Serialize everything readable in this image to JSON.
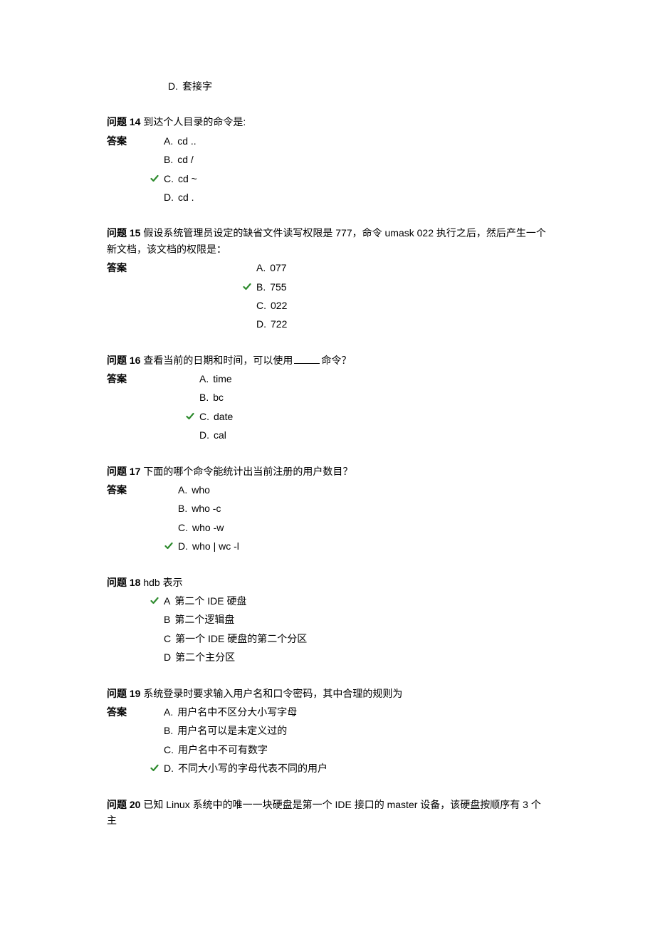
{
  "orphan_option": {
    "letter": "D.",
    "text": "套接字",
    "correct": false
  },
  "questions": [
    {
      "number": "问题 14",
      "text_before": "到达个人目录的命令是:",
      "text_after": "",
      "answer_label": "答案",
      "indent": 60,
      "options": [
        {
          "letter": "A.",
          "text": "cd ..",
          "correct": false
        },
        {
          "letter": "B.",
          "text": "cd /",
          "correct": false
        },
        {
          "letter": "C.",
          "text": "cd ~",
          "correct": true
        },
        {
          "letter": "D.",
          "text": "cd .",
          "correct": false
        }
      ]
    },
    {
      "number": "问题 15",
      "text_before": "假设系统管理员设定的缺省文件读写权限是 777，命令 umask 022 执行之后，然后产生一个新文档，该文档的权限是：",
      "text_after": "",
      "answer_label": "答案",
      "indent": 190,
      "options": [
        {
          "letter": "A.",
          "text": "077",
          "correct": false
        },
        {
          "letter": "B.",
          "text": "755",
          "correct": true
        },
        {
          "letter": "C.",
          "text": " 022",
          "correct": false
        },
        {
          "letter": "D.",
          "text": "722",
          "correct": false
        }
      ]
    },
    {
      "number": "问题 16",
      "text_before": "查看当前的日期和时间，可以使用",
      "text_after": "命令？",
      "has_blank": true,
      "answer_label": "答案",
      "indent": 110,
      "options": [
        {
          "letter": "A.",
          "text": "time",
          "correct": false
        },
        {
          "letter": "B.",
          "text": "bc",
          "correct": false
        },
        {
          "letter": "C.",
          "text": "date",
          "correct": true
        },
        {
          "letter": "D.",
          "text": "cal",
          "correct": false
        }
      ]
    },
    {
      "number": "问题 17",
      "text_before": "下面的哪个命令能统计出当前注册的用户数目？",
      "text_after": "",
      "answer_label": "答案",
      "indent": 80,
      "options": [
        {
          "letter": "A.",
          "text": " who",
          "correct": false
        },
        {
          "letter": "B.",
          "text": "who -c",
          "correct": false
        },
        {
          "letter": "C.",
          "text": "who -w",
          "correct": false
        },
        {
          "letter": "D.",
          "text": "who | wc -l",
          "correct": true
        }
      ]
    },
    {
      "number": "问题 18",
      "text_before": "hdb 表示",
      "text_after": "",
      "answer_label": "",
      "indent": 0,
      "options": [
        {
          "letter": "A",
          "text": "第二个 IDE 硬盘",
          "correct": true
        },
        {
          "letter": "B",
          "text": "第二个逻辑盘",
          "correct": false
        },
        {
          "letter": "C",
          "text": "第一个 IDE 硬盘的第二个分区",
          "correct": false
        },
        {
          "letter": "D",
          "text": "第二个主分区",
          "correct": false
        }
      ]
    },
    {
      "number": "问题 19",
      "text_before": "系统登录时要求输入用户名和口令密码，其中合理的规则为",
      "text_after": "",
      "answer_label": "答案",
      "indent": 60,
      "options": [
        {
          "letter": "A.",
          "text": "用户名中不区分大小写字母",
          "correct": false
        },
        {
          "letter": "B.",
          "text": "用户名可以是未定义过的",
          "correct": false
        },
        {
          "letter": "C.",
          "text": "用户名中不可有数字",
          "correct": false
        },
        {
          "letter": "D.",
          "text": "不同大小写的字母代表不同的用户",
          "correct": true
        }
      ]
    },
    {
      "number": "问题 20",
      "text_before": "已知 Linux 系统中的唯一一块硬盘是第一个 IDE 接口的 master 设备，该硬盘按顺序有 3 个主",
      "text_after": "",
      "answer_label": "",
      "indent": 0,
      "options": []
    }
  ],
  "colors": {
    "checkmark": "#2e8b2e",
    "text": "#000000"
  }
}
